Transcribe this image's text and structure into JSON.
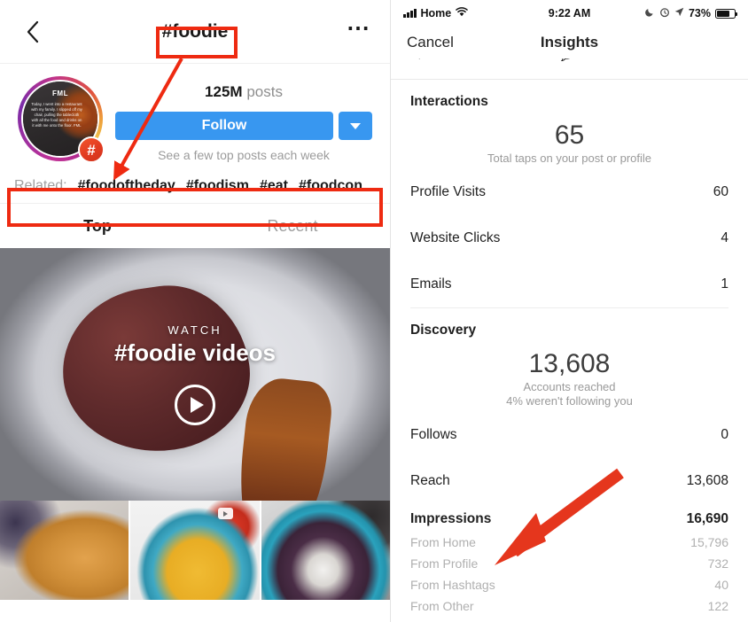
{
  "colors": {
    "ig_blue": "#3897f0",
    "annotation_red": "#ee2a11",
    "text_primary": "#1a1a1a",
    "text_muted": "#9b9b9b"
  },
  "left_panel": {
    "navbar": {
      "back_icon": "chevron-left-icon",
      "title": "#foodie",
      "more_icon": "ellipsis-icon"
    },
    "profile": {
      "avatar_label": "FML",
      "avatar_caption": "Today, I went into a restaurant with my family. I slipped off my chair, pulling the tablecloth with all the food and drinks on it with me onto the floor. FML",
      "badge_icon": "hashtag-badge-icon",
      "posts_count": "125M",
      "posts_label": "posts",
      "follow_label": "Follow",
      "follow_dropdown_icon": "chevron-down-icon",
      "follow_subtext": "See a few top posts each week"
    },
    "related": {
      "label": "Related:",
      "tags": [
        "#foodoftheday",
        "#foodism",
        "#eat",
        "#foodcon"
      ]
    },
    "tabs": [
      {
        "label": "Top",
        "active": true
      },
      {
        "label": "Recent",
        "active": false
      }
    ],
    "hero": {
      "watch_label": "WATCH",
      "watch_title": "#foodie videos",
      "play_icon": "play-icon"
    },
    "thumbnails": [
      {
        "alt": "cheesecake-slice-with-thyme"
      },
      {
        "alt": "yellow-rice-bowl-with-broccoli-and-tomatoes",
        "badge_icon": "video-icon"
      },
      {
        "alt": "salad-platter-with-pomegranate"
      }
    ]
  },
  "right_panel": {
    "status_bar": {
      "signal_icon": "signal-bars-icon",
      "carrier": "Home",
      "wifi_icon": "wifi-icon",
      "time": "9:22 AM",
      "dnd_icon": "moon-icon",
      "alarm_icon": "alarm-clock-icon",
      "location_icon": "location-arrow-icon",
      "battery_percent": "73%",
      "battery_icon": "battery-icon"
    },
    "navbar": {
      "cancel_label": "Cancel",
      "title": "Insights"
    },
    "clipped_row": [
      {
        "icon": "heart-icon",
        "value": ""
      },
      {
        "icon": "comment-icon",
        "value": ""
      },
      {
        "icon": "share-icon",
        "value": ""
      }
    ],
    "interactions": {
      "section_title": "Interactions",
      "total": "65",
      "total_caption": "Total taps on your post or profile",
      "rows": [
        {
          "label": "Profile Visits",
          "value": "60"
        },
        {
          "label": "Website Clicks",
          "value": "4"
        },
        {
          "label": "Emails",
          "value": "1"
        }
      ]
    },
    "discovery": {
      "section_title": "Discovery",
      "total": "13,608",
      "caption_line1": "Accounts reached",
      "caption_line2": "4% weren't following you",
      "rows": [
        {
          "label": "Follows",
          "value": "0"
        },
        {
          "label": "Reach",
          "value": "13,608"
        }
      ],
      "impressions": {
        "label": "Impressions",
        "value": "16,690",
        "breakdown": [
          {
            "label": "From Home",
            "value": "15,796"
          },
          {
            "label": "From Profile",
            "value": "732"
          },
          {
            "label": "From Hashtags",
            "value": "40"
          },
          {
            "label": "From Other",
            "value": "122"
          }
        ]
      }
    }
  },
  "annotations": [
    {
      "name": "title-callout-box",
      "target": "#foodie"
    },
    {
      "name": "related-callout-box",
      "target": "Related hashtags row"
    },
    {
      "name": "title-to-related-arrow",
      "target": "points from #foodie to Related row"
    },
    {
      "name": "hashtags-impressions-arrow",
      "target": "points to From Hashtags"
    }
  ]
}
